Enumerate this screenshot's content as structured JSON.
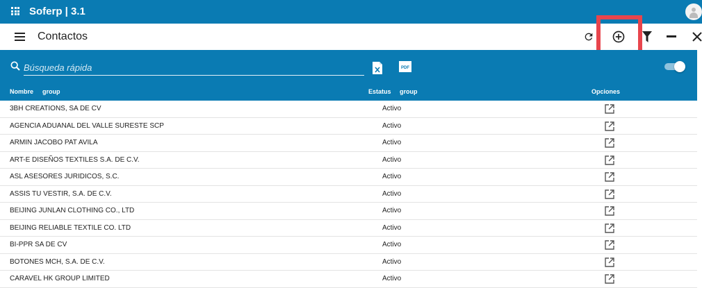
{
  "app": {
    "title": "Soferp | 3.1"
  },
  "toolbar": {
    "page_title": "Contactos",
    "buttons": [
      {
        "name": "refresh-icon"
      },
      {
        "name": "add-circle-icon"
      },
      {
        "name": "filter-icon"
      },
      {
        "name": "minimize-icon"
      },
      {
        "name": "close-icon"
      }
    ]
  },
  "search": {
    "placeholder": "Búsqueda rápida",
    "value": ""
  },
  "export": {
    "excel_icon": "excel-file-icon",
    "pdf_icon": "pdf-file-icon",
    "pdf_label": "PDF"
  },
  "colors": {
    "primary": "#0a7bb3",
    "highlight": "#e8454d"
  },
  "table": {
    "headers": {
      "name": "Nombre",
      "name_group": "group",
      "status": "Estatus",
      "status_group": "group",
      "options": "Opciones"
    },
    "rows": [
      {
        "name": "3BH CREATIONS, SA DE CV",
        "status": "Activo"
      },
      {
        "name": "AGENCIA ADUANAL DEL VALLE SURESTE SCP",
        "status": "Activo"
      },
      {
        "name": "ARMIN JACOBO PAT AVILA",
        "status": "Activo"
      },
      {
        "name": "ART-E DISEÑOS TEXTILES S.A. DE C.V.",
        "status": "Activo"
      },
      {
        "name": "ASL ASESORES JURIDICOS, S.C.",
        "status": "Activo"
      },
      {
        "name": "ASSIS TU VESTIR, S.A. DE C.V.",
        "status": "Activo"
      },
      {
        "name": "BEIJING JUNLAN CLOTHING CO., LTD",
        "status": "Activo"
      },
      {
        "name": "BEIJING RELIABLE TEXTILE CO. LTD",
        "status": "Activo"
      },
      {
        "name": "BI-PPR SA DE CV",
        "status": "Activo"
      },
      {
        "name": "BOTONES MCH, S.A. DE C.V.",
        "status": "Activo"
      },
      {
        "name": "CARAVEL HK GROUP LIMITED",
        "status": "Activo"
      }
    ]
  }
}
